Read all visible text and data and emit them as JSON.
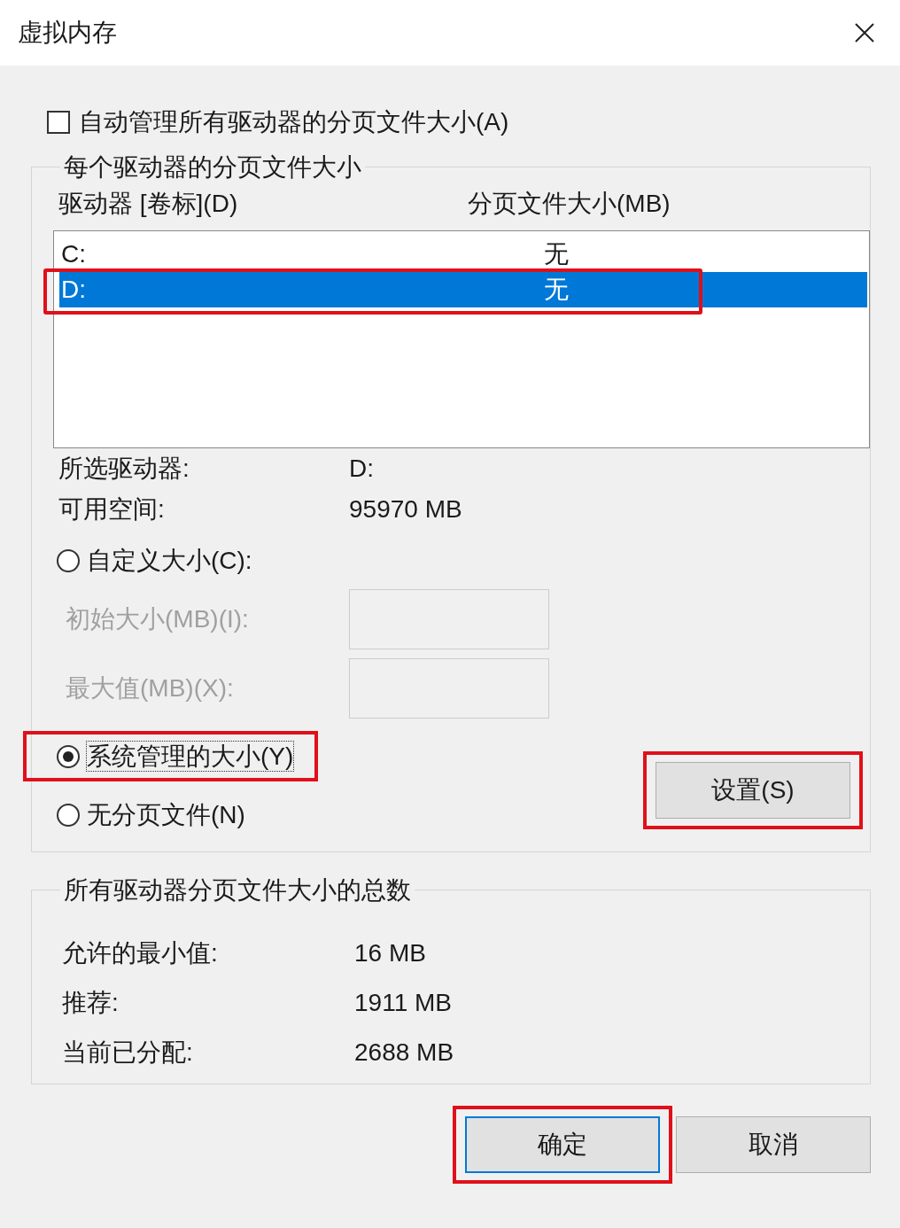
{
  "window": {
    "title": "虚拟内存"
  },
  "auto_manage": {
    "label": "自动管理所有驱动器的分页文件大小(A)",
    "checked": false
  },
  "per_drive": {
    "title": "每个驱动器的分页文件大小",
    "columns": [
      "驱动器 [卷标](D)",
      "分页文件大小(MB)"
    ],
    "drives": [
      {
        "drive": "C:",
        "size": "无",
        "selected": false,
        "highlighted": false
      },
      {
        "drive": "D:",
        "size": "无",
        "selected": true,
        "highlighted": true
      }
    ],
    "info": [
      {
        "label": "所选驱动器:",
        "value": "D:"
      },
      {
        "label": "可用空间:",
        "value": "95970 MB"
      }
    ],
    "options": [
      {
        "label": "自定义大小(C):",
        "selected": false,
        "highlighted": false
      },
      {
        "label": "系统管理的大小(Y)",
        "selected": true,
        "highlighted": true
      },
      {
        "label": "无分页文件(N)",
        "selected": false,
        "highlighted": false
      }
    ],
    "fields": [
      {
        "label": "初始大小(MB)(I):",
        "disabled": true
      },
      {
        "label": "最大值(MB)(X):",
        "disabled": true
      }
    ],
    "set_button": {
      "label": "设置(S)",
      "highlighted": true
    }
  },
  "totals": {
    "title": "所有驱动器分页文件大小的总数",
    "rows": [
      {
        "label": "允许的最小值:",
        "value": "16 MB"
      },
      {
        "label": "推荐:",
        "value": "1911 MB"
      },
      {
        "label": "当前已分配:",
        "value": "2688 MB"
      }
    ]
  },
  "buttons": [
    {
      "label": "确定",
      "default": true,
      "highlighted": true
    },
    {
      "label": "取消",
      "default": false,
      "highlighted": false
    }
  ]
}
